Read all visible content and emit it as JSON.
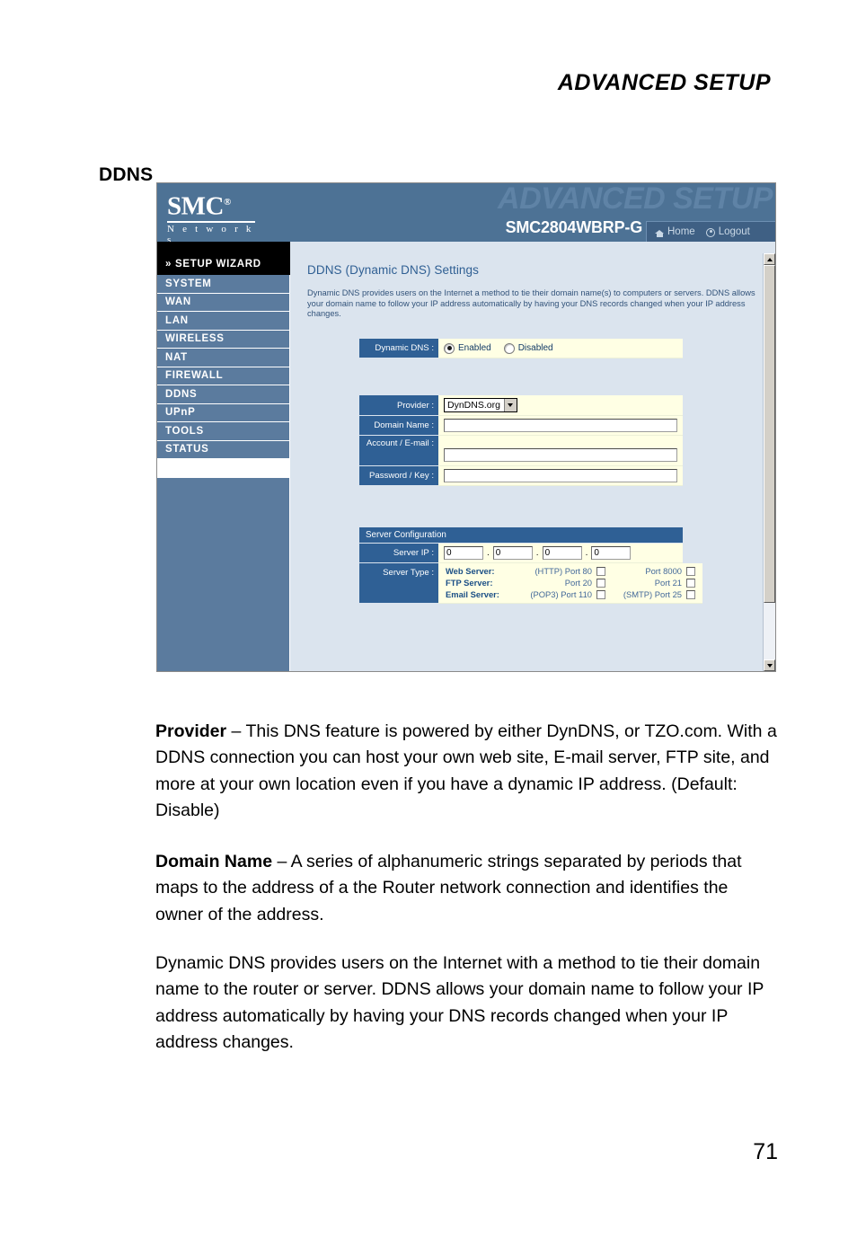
{
  "document": {
    "running_head": "ADVANCED SETUP",
    "section_title": "DDNS",
    "page_number": "71",
    "paragraphs": {
      "provider_term": "Provider",
      "provider_text": " – This DNS feature is powered by either DynDNS, or TZO.com. With a DDNS connection you can host your own web site, E-mail server, FTP site, and more at your own location even if you have a dynamic IP address. (Default: Disable)",
      "domain_term": "Domain Name",
      "domain_text": " – A series of alphanumeric strings separated by periods that maps to the address of a the Router network connection and identifies the owner of the address.",
      "dyndns_text": "Dynamic DNS provides users on the Internet with a method to tie their domain name to the router or server. DDNS allows your domain name to follow your IP address automatically by having your DNS records changed when your IP address changes."
    }
  },
  "screenshot": {
    "banner": {
      "ghost_text": "ADVANCED SETUP",
      "logo_smc": "SMC",
      "logo_registered": "®",
      "logo_networks": "N e t w o r k s",
      "model": "SMC2804WBRP-G",
      "home_label": "Home",
      "logout_label": "Logout",
      "home_icon": "home-icon",
      "logout_icon": "power-logout-icon"
    },
    "sidebar": {
      "wizard_label": "» SETUP WIZARD",
      "items": [
        {
          "label": "SYSTEM"
        },
        {
          "label": "WAN"
        },
        {
          "label": "LAN"
        },
        {
          "label": "WIRELESS"
        },
        {
          "label": "NAT"
        },
        {
          "label": "FIREWALL"
        },
        {
          "label": "DDNS"
        },
        {
          "label": "UPnP"
        },
        {
          "label": "TOOLS"
        },
        {
          "label": "STATUS"
        }
      ]
    },
    "content": {
      "title": "DDNS (Dynamic DNS) Settings",
      "description": "Dynamic DNS provides users on the Internet a method to tie their domain name(s) to computers or servers. DDNS allows your domain name to follow your IP address automatically by having your DNS records changed when your IP address changes.",
      "dynamic_dns": {
        "label": "Dynamic DNS :",
        "enabled_label": "Enabled",
        "disabled_label": "Disabled",
        "selected": "Enabled"
      },
      "provider": {
        "label": "Provider :",
        "value": "DynDNS.org"
      },
      "domain_name": {
        "label": "Domain Name :",
        "value": ""
      },
      "account_email": {
        "label": "Account / E-mail :",
        "value": ""
      },
      "password_key": {
        "label": "Password / Key :",
        "value": ""
      },
      "server_configuration": {
        "header": "Server Configuration",
        "server_ip_label": "Server IP :",
        "server_ip_octets": [
          "0",
          "0",
          "0",
          "0"
        ],
        "server_type_label": "Server Type :",
        "rows": [
          {
            "service": "Web Server:",
            "port_a": "(HTTP) Port 80",
            "checked_a": false,
            "port_b": "Port 8000",
            "checked_b": false
          },
          {
            "service": "FTP Server:",
            "port_a": "Port 20",
            "checked_a": false,
            "port_b": "Port 21",
            "checked_b": false
          },
          {
            "service": "Email Server:",
            "port_a": "(POP3) Port 110",
            "checked_a": false,
            "port_b": "(SMTP) Port 25",
            "checked_b": false
          }
        ]
      }
    },
    "scrollbar": {
      "up_icon": "scroll-up-arrow-icon",
      "down_icon": "scroll-down-arrow-icon"
    }
  },
  "colors": {
    "banner_blue": "#4d7295",
    "banner_ghost": "#5f83a6",
    "menu_blue": "#5b7b9e",
    "label_blue": "#2f6095",
    "content_bg": "#dbe4ee",
    "field_cream": "#ffffe4",
    "nav_box": "#3f6084"
  }
}
